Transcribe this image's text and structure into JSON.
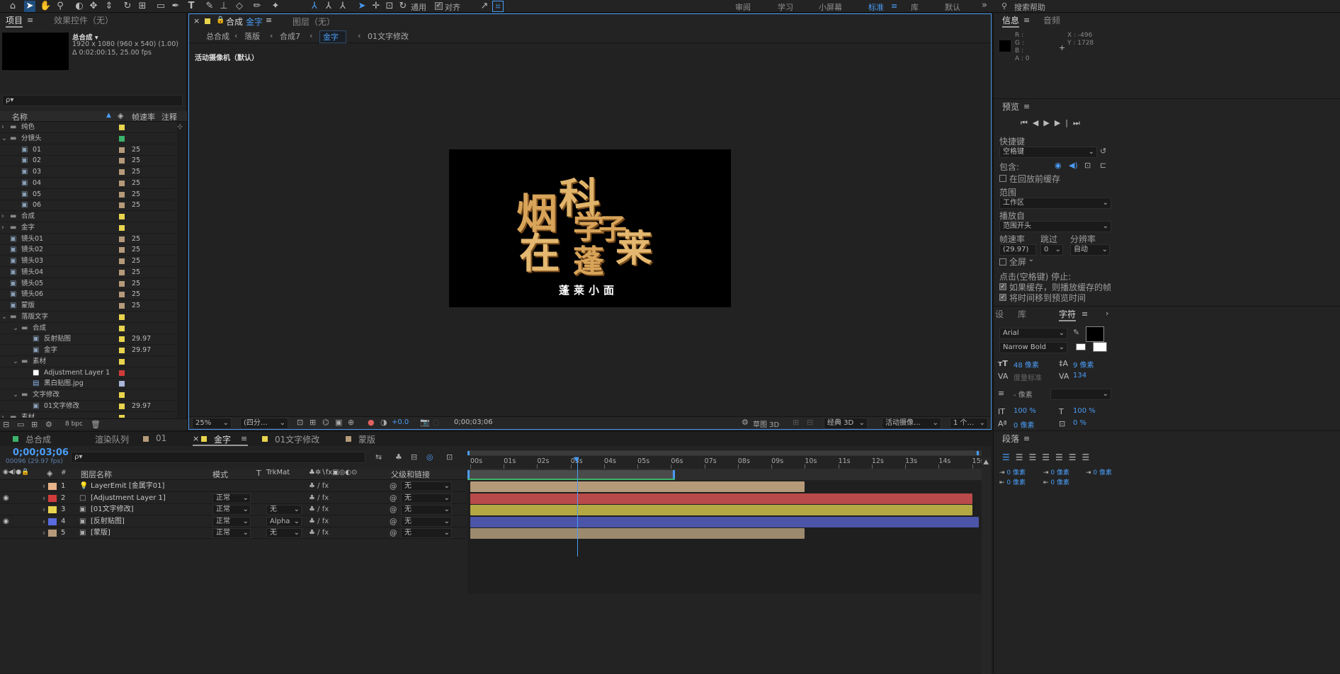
{
  "toolbar": {
    "snap_label": "对齐",
    "workspaces": [
      "审阅",
      "学习",
      "小屏幕",
      "标准",
      "库",
      "默认"
    ],
    "search_placeholder": "搜索帮助",
    "general_label": "通用"
  },
  "project_panel": {
    "tabs": [
      "项目",
      "效果控件（无）"
    ],
    "comp_name": "总合成",
    "comp_info_1": "1920 x 1080 (960 x 540) (1.00)",
    "comp_info_2": "Δ 0:02:00:15, 25.00 fps",
    "search_placeholder": "ρ▾",
    "columns": [
      "名称",
      "帧速率",
      "注释"
    ],
    "items": [
      {
        "indent": 0,
        "expand": "›",
        "type": "folder",
        "name": "纯色",
        "color": "#e8d44d",
        "fps": ""
      },
      {
        "indent": 0,
        "expand": "⌄",
        "type": "folder",
        "name": "分镜头",
        "color": "#3bb36a",
        "fps": ""
      },
      {
        "indent": 1,
        "expand": "",
        "type": "comp",
        "name": "01",
        "color": "#b59a7a",
        "fps": "25"
      },
      {
        "indent": 1,
        "expand": "",
        "type": "comp",
        "name": "02",
        "color": "#b59a7a",
        "fps": "25"
      },
      {
        "indent": 1,
        "expand": "",
        "type": "comp",
        "name": "03",
        "color": "#b59a7a",
        "fps": "25"
      },
      {
        "indent": 1,
        "expand": "",
        "type": "comp",
        "name": "04",
        "color": "#b59a7a",
        "fps": "25"
      },
      {
        "indent": 1,
        "expand": "",
        "type": "comp",
        "name": "05",
        "color": "#b59a7a",
        "fps": "25"
      },
      {
        "indent": 1,
        "expand": "",
        "type": "comp",
        "name": "06",
        "color": "#b59a7a",
        "fps": "25"
      },
      {
        "indent": 0,
        "expand": "›",
        "type": "folder",
        "name": "合成",
        "color": "#e8d44d",
        "fps": ""
      },
      {
        "indent": 0,
        "expand": "›",
        "type": "folder",
        "name": "金字",
        "color": "#e8d44d",
        "fps": ""
      },
      {
        "indent": 0,
        "expand": "",
        "type": "comp",
        "name": "镜头01",
        "color": "#b59a7a",
        "fps": "25"
      },
      {
        "indent": 0,
        "expand": "",
        "type": "comp",
        "name": "镜头02",
        "color": "#b59a7a",
        "fps": "25"
      },
      {
        "indent": 0,
        "expand": "",
        "type": "comp",
        "name": "镜头03",
        "color": "#b59a7a",
        "fps": "25"
      },
      {
        "indent": 0,
        "expand": "",
        "type": "comp",
        "name": "镜头04",
        "color": "#b59a7a",
        "fps": "25"
      },
      {
        "indent": 0,
        "expand": "",
        "type": "comp",
        "name": "镜头05",
        "color": "#b59a7a",
        "fps": "25"
      },
      {
        "indent": 0,
        "expand": "",
        "type": "comp",
        "name": "镜头06",
        "color": "#b59a7a",
        "fps": "25"
      },
      {
        "indent": 0,
        "expand": "",
        "type": "comp",
        "name": "蒙版",
        "color": "#b59a7a",
        "fps": "25"
      },
      {
        "indent": 0,
        "expand": "⌄",
        "type": "folder",
        "name": "落版文字",
        "color": "#e8d44d",
        "fps": ""
      },
      {
        "indent": 1,
        "expand": "⌄",
        "type": "folder",
        "name": "合成",
        "color": "#e8d44d",
        "fps": ""
      },
      {
        "indent": 2,
        "expand": "",
        "type": "comp",
        "name": "反射贴图",
        "color": "#e8d44d",
        "fps": "29.97"
      },
      {
        "indent": 2,
        "expand": "",
        "type": "comp",
        "name": "金字",
        "color": "#e8d44d",
        "fps": "29.97"
      },
      {
        "indent": 1,
        "expand": "⌄",
        "type": "folder",
        "name": "素材",
        "color": "#e8d44d",
        "fps": ""
      },
      {
        "indent": 2,
        "expand": "",
        "type": "solid",
        "name": "Adjustment Layer 1",
        "color": "#d03c3c",
        "fps": ""
      },
      {
        "indent": 2,
        "expand": "",
        "type": "file",
        "name": "黑白贴图.jpg",
        "color": "#a9b6d8",
        "fps": ""
      },
      {
        "indent": 1,
        "expand": "⌄",
        "type": "folder",
        "name": "文字修改",
        "color": "#e8d44d",
        "fps": ""
      },
      {
        "indent": 2,
        "expand": "",
        "type": "comp",
        "name": "01文字修改",
        "color": "#e8d44d",
        "fps": "29.97"
      },
      {
        "indent": 0,
        "expand": "›",
        "type": "folder",
        "name": "素材",
        "color": "#e8d44d",
        "fps": ""
      }
    ],
    "bpc": "8 bpc"
  },
  "comp_panel": {
    "tab_prefix": "合成",
    "tab_name": "金字",
    "layer_tab": "图层（无）",
    "breadcrumbs": [
      "总合成",
      "落版",
      "合成7",
      "金字",
      "01文字修改"
    ],
    "camera_label": "活动摄像机（默认）",
    "poem": [
      "烟",
      "科",
      "学",
      "子",
      "在",
      "蓬",
      "莱"
    ],
    "subtitle": "蓬莱小面",
    "zoom": "25%",
    "resolution": "(四分…",
    "exposure": "+0.0",
    "timecode": "0;00;03;06",
    "draft3d": "草图 3D",
    "renderer": "经典 3D",
    "camera_select": "活动摄像…",
    "views": "1 个…"
  },
  "timeline": {
    "tabs": [
      {
        "name": "总合成",
        "color": "#3bb36a"
      },
      {
        "name": "渲染队列",
        "color": ""
      },
      {
        "name": "01",
        "color": "#b59a7a"
      },
      {
        "name": "金字",
        "color": "#e8d44d"
      },
      {
        "name": "01文字修改",
        "color": "#e8d44d"
      },
      {
        "name": "蒙版",
        "color": "#b59a7a"
      }
    ],
    "timecode": "0;00;03;06",
    "frame_info": "00096 (29.97 fps)",
    "col_name": "图层名称",
    "col_mode": "模式",
    "col_t": "T",
    "col_trkmat": "TrkMat",
    "col_parent": "父级和链接",
    "ruler": [
      "00s",
      "01s",
      "02s",
      "03s",
      "04s",
      "05s",
      "06s",
      "07s",
      "08s",
      "09s",
      "10s",
      "11s",
      "12s",
      "13s",
      "14s",
      "15s"
    ],
    "layers": [
      {
        "num": "1",
        "name": "LayerEmit [金属字01]",
        "color": "#e8b48a",
        "mode": "",
        "trkmat": "",
        "parent": "无",
        "bar_color": "#b59a7a",
        "bar_start": 0,
        "bar_end": 10.0
      },
      {
        "num": "2",
        "name": "[Adjustment Layer 1]",
        "color": "#d03c3c",
        "mode": "正常",
        "trkmat": "",
        "parent": "无",
        "bar_color": "#b84a4a",
        "bar_start": 0,
        "bar_end": 15
      },
      {
        "num": "3",
        "name": "[01文字修改]",
        "color": "#e8d44d",
        "mode": "正常",
        "trkmat": "无",
        "parent": "无",
        "bar_color": "#b4a844",
        "bar_start": 0,
        "bar_end": 15
      },
      {
        "num": "4",
        "name": "[反射贴图]",
        "color": "#5a6be0",
        "mode": "正常",
        "trkmat": "Alpha",
        "parent": "无",
        "bar_color": "#4c55a8",
        "bar_start": 0,
        "bar_end": 15.2
      },
      {
        "num": "5",
        "name": "[蒙版]",
        "color": "#b59a7a",
        "mode": "正常",
        "trkmat": "无",
        "parent": "无",
        "bar_color": "#9c8a6e",
        "bar_start": 0,
        "bar_end": 10.0
      }
    ],
    "playhead_seconds": 3.2,
    "work_area_end": 6.2
  },
  "right_panel": {
    "info_tabs": [
      "信息",
      "音频"
    ],
    "rgba": [
      "R :",
      "G :",
      "B :",
      "A : 0"
    ],
    "xy": [
      "X : -496",
      "Y : 1728"
    ],
    "preview_title": "预览",
    "shortcut_label": "快捷键",
    "shortcut_value": "空格键",
    "include_label": "包含:",
    "cache_label": "在回放前缓存",
    "range_label": "范围",
    "range_value": "工作区",
    "playfrom_label": "播放自",
    "playfrom_value": "范围开头",
    "fps_label": "帧速率",
    "skip_label": "跳过",
    "res_label": "分辨率",
    "fps_value": "(29.97)",
    "skip_value": "0",
    "res_value": "自动",
    "fullscreen_label": "全屏",
    "stop_label": "点击(空格键) 停止:",
    "stop_opt1": "如果缓存，则播放缓存的帧",
    "stop_opt2": "将时间移到预览时间",
    "char_tabs": [
      "设",
      "库",
      "字符"
    ],
    "font": "Arial",
    "style": "Narrow Bold",
    "font_size": "48 像素",
    "leading": "9 像素",
    "tracking": "度量标准",
    "kerning": "134",
    "stroke": "- 像素",
    "vscale": "100 %",
    "hscale": "100 %",
    "baseline": "0 像素",
    "tsume": "0 %",
    "para_title": "段落",
    "para_vals": [
      "0 像素",
      "0 像素",
      "0 像素",
      "0 像素",
      "0 像素"
    ]
  }
}
